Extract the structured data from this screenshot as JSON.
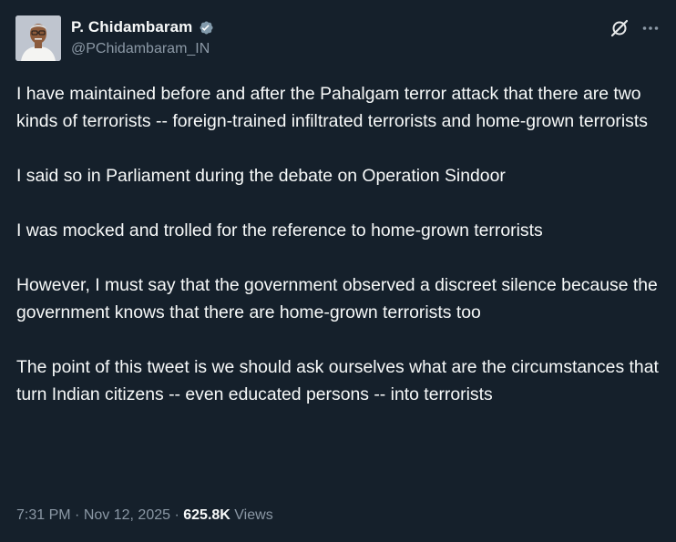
{
  "header": {
    "display_name": "P. Chidambaram",
    "handle": "@PChidambaram_IN",
    "verified_icon": "verified-badge-icon",
    "grok_icon": "grok-slash-icon",
    "more_icon": "more-horizontal-icon"
  },
  "tweet": {
    "paragraphs": [
      "I have maintained before and after the Pahalgam terror attack that there are two kinds of terrorists -- foreign-trained infiltrated terrorists and home-grown terrorists",
      "I said so in Parliament during the debate on Operation Sindoor",
      "I was mocked and trolled for the reference to home-grown terrorists",
      "However, I must say that the government observed a discreet silence because the government knows that there are home-grown terrorists too",
      "The point of this tweet is we should ask ourselves what are the circumstances that turn Indian citizens -- even educated persons -- into terrorists"
    ]
  },
  "meta": {
    "time": "7:31 PM",
    "separator": "·",
    "date": "Nov 12, 2025",
    "views_count": "625.8K",
    "views_label": "Views"
  },
  "colors": {
    "background": "#15202b",
    "text": "#f7f9f9",
    "secondary_text": "#8b98a5",
    "verified_badge": "#829aab"
  }
}
